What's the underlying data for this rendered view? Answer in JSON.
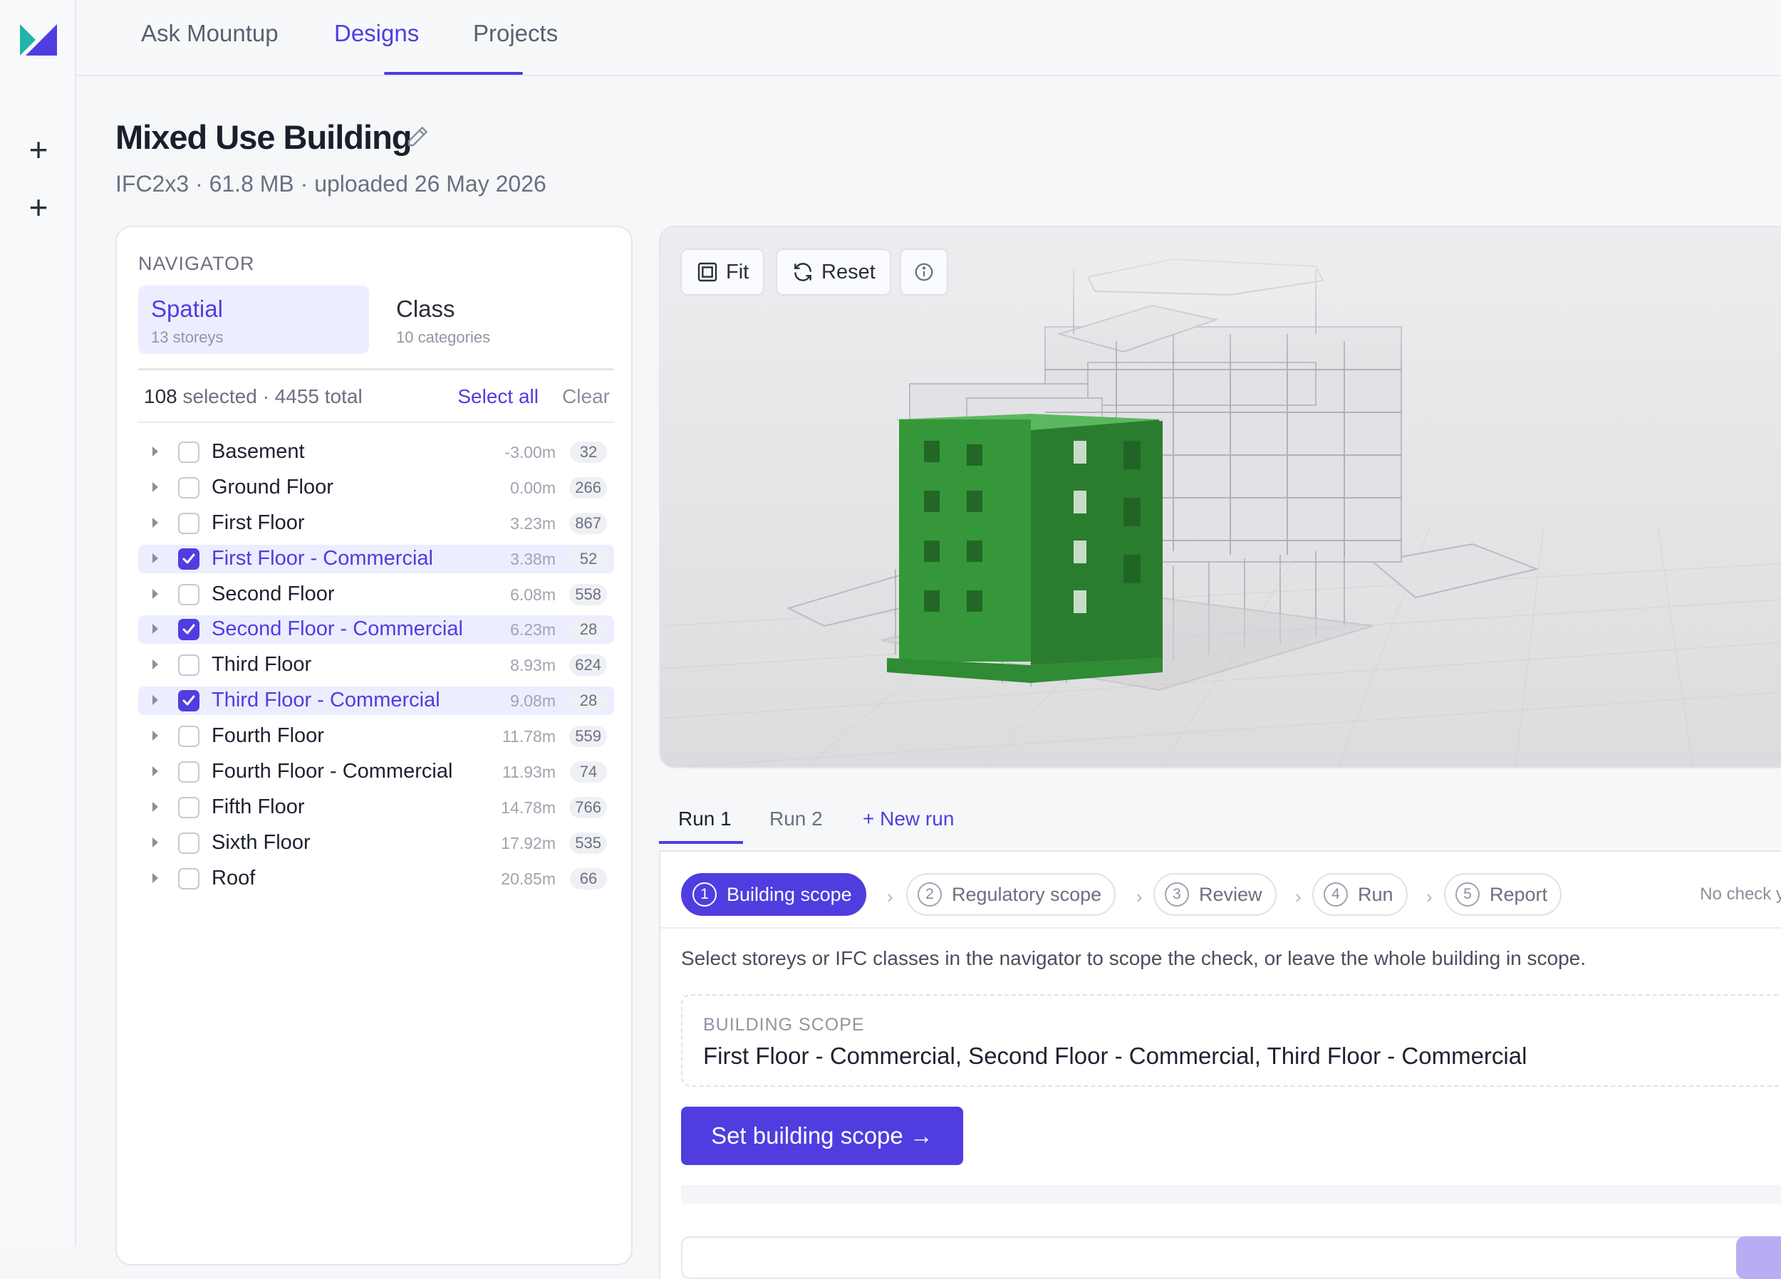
{
  "brand": {
    "logo_colors": [
      "#4f3de0",
      "#23b3a8"
    ]
  },
  "sidebar": {
    "buttons": [
      "add-icon",
      "add-icon"
    ]
  },
  "topnav": {
    "tabs": [
      {
        "label": "Ask Mountup"
      },
      {
        "label": "Designs"
      },
      {
        "label": "Projects"
      }
    ],
    "active": "Designs"
  },
  "project": {
    "title": "Mixed Use Building",
    "meta": "IFC2x3 · 61.8 MB · uploaded 26 May 2026"
  },
  "navigator": {
    "heading": "NAVIGATOR",
    "segments": [
      {
        "title": "Spatial",
        "sub": "13 storeys"
      },
      {
        "title": "Class",
        "sub": "10 categories"
      }
    ],
    "selection": {
      "count": "108",
      "selected_label": "selected",
      "total": "· 4455 total",
      "select_all": "Select all",
      "clear": "Clear"
    },
    "storeys": [
      {
        "name": "Basement",
        "elevation": "-3.00m",
        "count": "32",
        "checked": false
      },
      {
        "name": "Ground Floor",
        "elevation": "0.00m",
        "count": "266",
        "checked": false
      },
      {
        "name": "First Floor",
        "elevation": "3.23m",
        "count": "867",
        "checked": false
      },
      {
        "name": "First Floor - Commercial",
        "elevation": "3.38m",
        "count": "52",
        "checked": true
      },
      {
        "name": "Second Floor",
        "elevation": "6.08m",
        "count": "558",
        "checked": false
      },
      {
        "name": "Second Floor - Commercial",
        "elevation": "6.23m",
        "count": "28",
        "checked": true
      },
      {
        "name": "Third Floor",
        "elevation": "8.93m",
        "count": "624",
        "checked": false
      },
      {
        "name": "Third Floor - Commercial",
        "elevation": "9.08m",
        "count": "28",
        "checked": true
      },
      {
        "name": "Fourth Floor",
        "elevation": "11.78m",
        "count": "559",
        "checked": false
      },
      {
        "name": "Fourth Floor - Commercial",
        "elevation": "11.93m",
        "count": "74",
        "checked": false
      },
      {
        "name": "Fifth Floor",
        "elevation": "14.78m",
        "count": "766",
        "checked": false
      },
      {
        "name": "Sixth Floor",
        "elevation": "17.92m",
        "count": "535",
        "checked": false
      },
      {
        "name": "Roof",
        "elevation": "20.85m",
        "count": "66",
        "checked": false
      }
    ]
  },
  "viewer": {
    "fit_label": "Fit",
    "reset_label": "Reset",
    "highlight_color": "#2e8b34"
  },
  "runs": {
    "tabs": [
      "Run 1",
      "Run 2"
    ],
    "new_run": "+ New run"
  },
  "wizard": {
    "steps": [
      {
        "num": "1",
        "label": "Building scope"
      },
      {
        "num": "2",
        "label": "Regulatory scope"
      },
      {
        "num": "3",
        "label": "Review"
      },
      {
        "num": "4",
        "label": "Run"
      },
      {
        "num": "5",
        "label": "Report"
      }
    ],
    "status": "No check yet",
    "instruction": "Select storeys or IFC classes in the navigator to scope the check, or leave the whole building in scope.",
    "scope_label": "BUILDING SCOPE",
    "scope_value": "First Floor - Commercial, Second Floor - Commercial, Third Floor - Commercial",
    "cta": "Set building scope →"
  }
}
